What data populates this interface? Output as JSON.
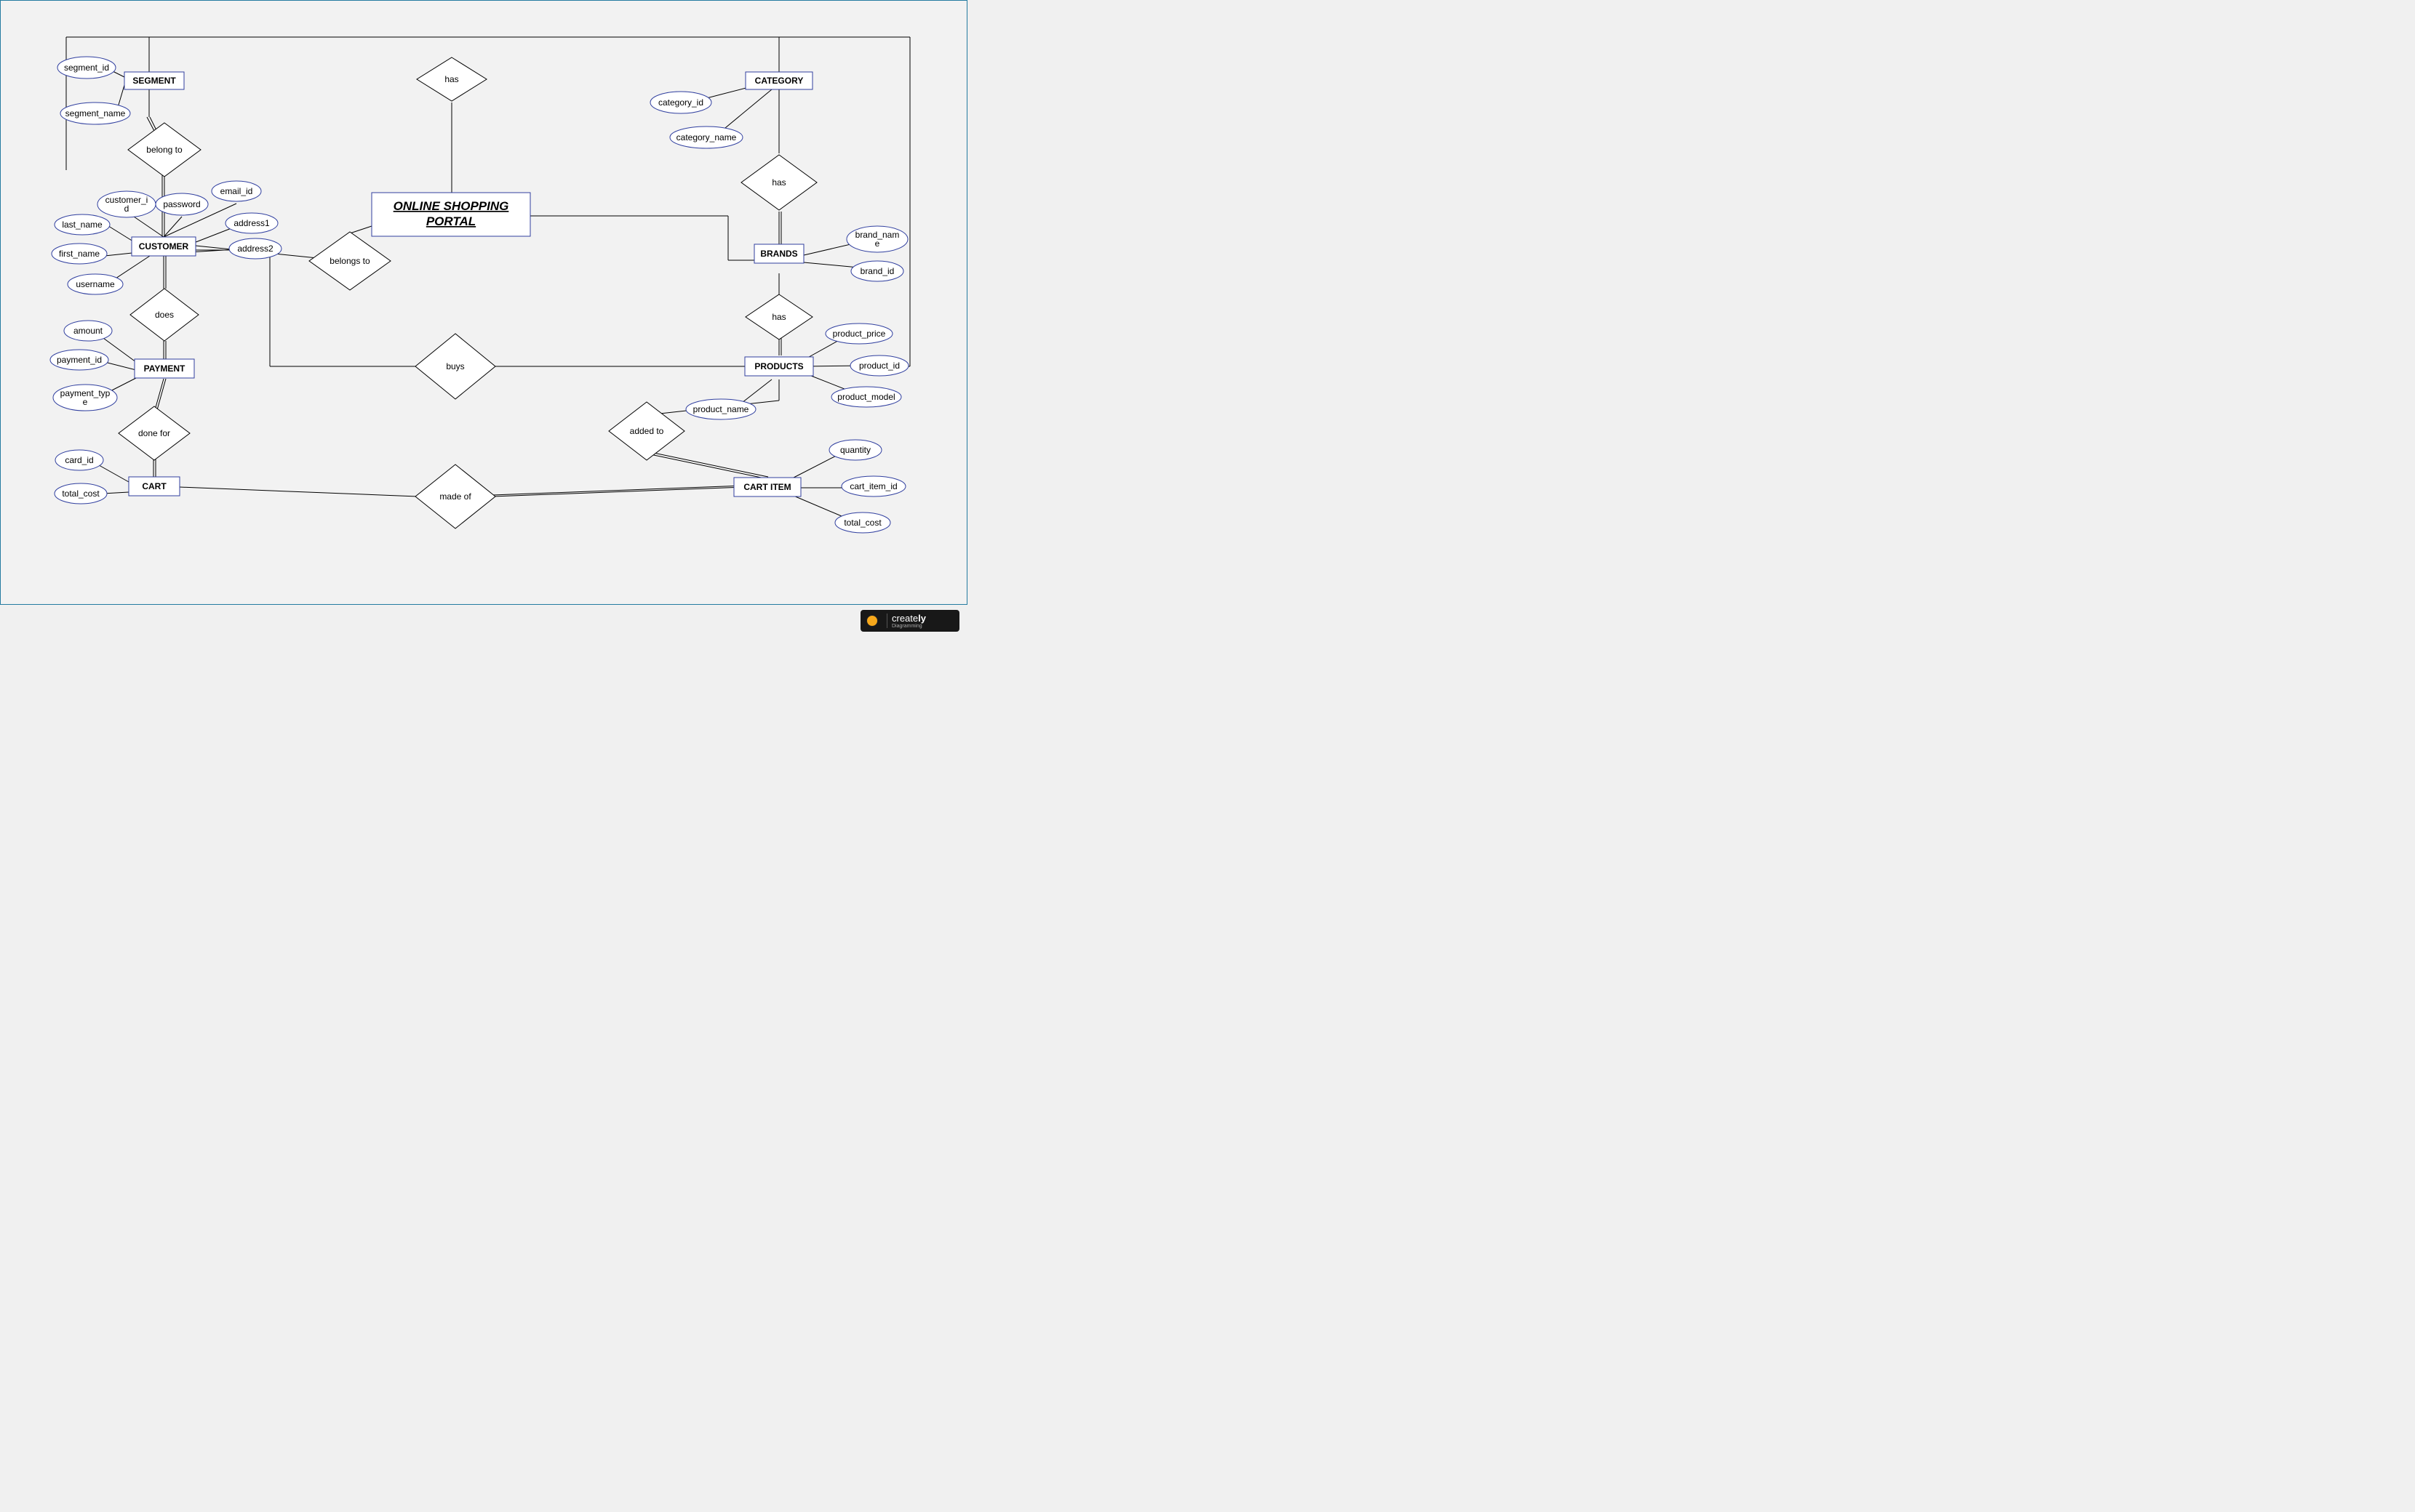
{
  "central": {
    "line1": "ONLINE SHOPPING",
    "line2": "PORTAL"
  },
  "entities": {
    "segment": "SEGMENT",
    "customer": "CUSTOMER",
    "payment": "PAYMENT",
    "cart": "CART",
    "category": "CATEGORY",
    "brands": "BRANDS",
    "products": "PRODUCTS",
    "cart_item": "CART ITEM"
  },
  "relationships": {
    "has_top": "has",
    "belong_to": "belong to",
    "has_cat_brand": "has",
    "belongs_to": "belongs to",
    "does": "does",
    "has_brand_prod": "has",
    "buys": "buys",
    "done_for": "done for",
    "added_to": "added to",
    "made_of": "made of"
  },
  "attributes": {
    "segment_id": "segment_id",
    "segment_name": "segment_name",
    "customer_id": "customer_id",
    "password": "password",
    "email_id": "email_id",
    "last_name": "last_name",
    "address1": "address1",
    "first_name": "first_name",
    "address2": "address2",
    "username": "username",
    "amount": "amount",
    "payment_id": "payment_id",
    "payment_type": "payment_type",
    "card_id": "card_id",
    "total_cost_cart": "total_cost",
    "category_id": "category_id",
    "category_name": "category_name",
    "brand_name": "brand_name",
    "brand_id": "brand_id",
    "product_price": "product_price",
    "product_id": "product_id",
    "product_model": "product_model",
    "product_name": "product_name",
    "quantity": "quantity",
    "cart_item_id": "cart_item_id",
    "total_cost_item": "total_cost"
  },
  "logo": {
    "brand": "creately",
    "sub": "Diagramming"
  }
}
